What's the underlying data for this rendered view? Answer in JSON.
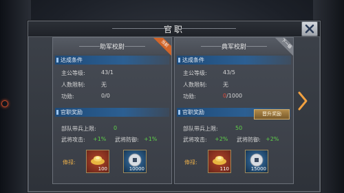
{
  "title": "官职",
  "cards": [
    {
      "name": "助军校尉",
      "ribbon": "当前",
      "ribbon_color": "orange",
      "conditions_header": "达成条件",
      "conditions": [
        {
          "label": "主公等级:",
          "value": "43/1"
        },
        {
          "label": "人数限制:",
          "value": "无"
        },
        {
          "label": "功勋:",
          "value": "0/0"
        }
      ],
      "rewards_header": "官职奖励",
      "troop_limit_label": "部队带兵上限:",
      "troop_limit_value": "0",
      "attack_label": "武将攻击:",
      "attack_value": "+1%",
      "defense_label": "武将防御:",
      "defense_value": "+1%",
      "salary_label": "俸禄:",
      "items": [
        {
          "icon": "gold-ingot-icon",
          "count": "100"
        },
        {
          "icon": "coin-icon",
          "count": "10000"
        }
      ]
    },
    {
      "name": "典军校尉",
      "ribbon": "下一级",
      "ribbon_color": "gray",
      "conditions_header": "达成条件",
      "conditions": [
        {
          "label": "主公等级:",
          "value": "43/5"
        },
        {
          "label": "人数限制:",
          "value": "无"
        },
        {
          "label": "功勋:",
          "value_red": "0",
          "value_rest": "/1000"
        }
      ],
      "rewards_header": "官职奖励",
      "promote_button": "晋升奖励",
      "troop_limit_label": "部队带兵上限:",
      "troop_limit_value": "50",
      "attack_label": "武将攻击:",
      "attack_value": "+2%",
      "defense_label": "武将防御:",
      "defense_value": "+2%",
      "salary_label": "俸禄:",
      "items": [
        {
          "icon": "gold-ingot-icon",
          "count": "110"
        },
        {
          "icon": "coin-icon",
          "count": "15000"
        }
      ]
    }
  ],
  "colors": {
    "accent_green": "#5fd04a",
    "accent_red": "#e04a3a",
    "section_blue": "#2c5f92",
    "ribbon_orange": "#d0652a"
  }
}
